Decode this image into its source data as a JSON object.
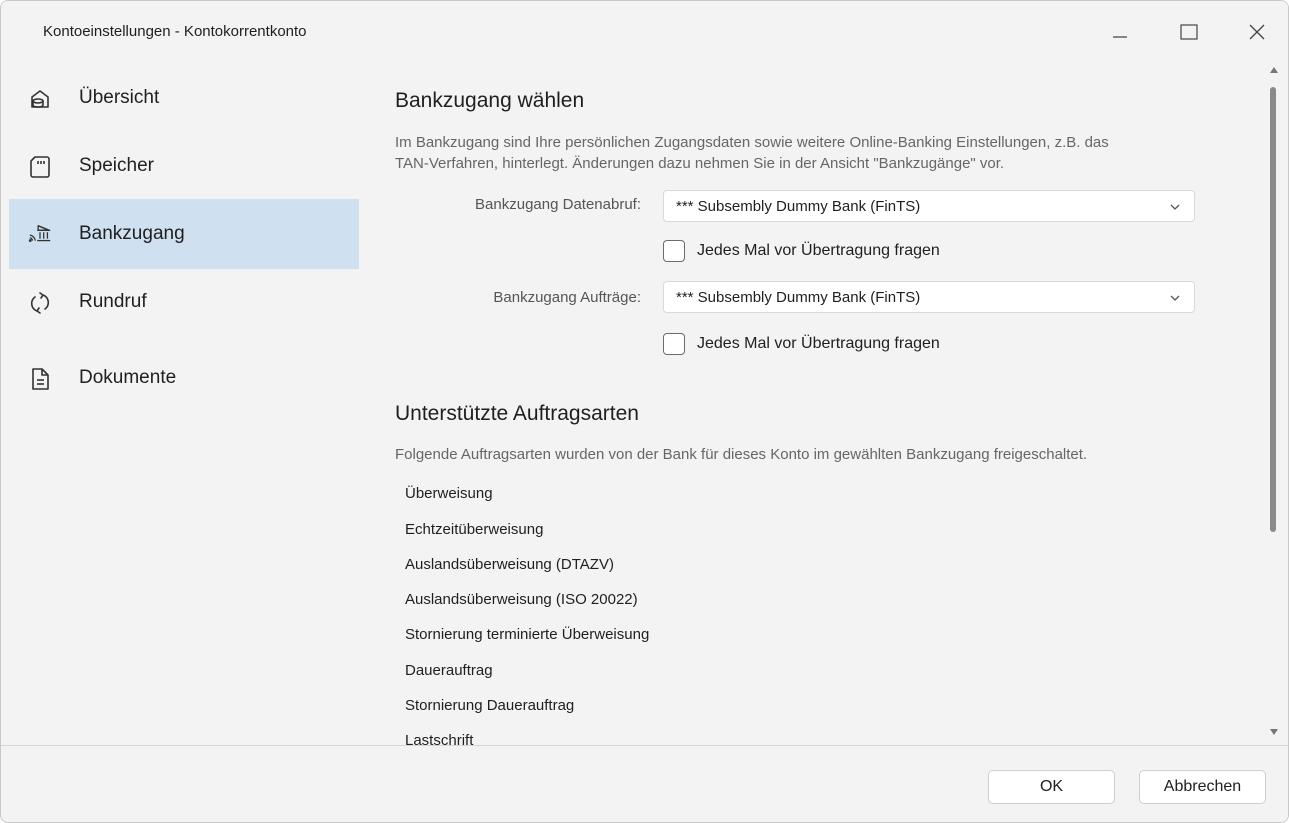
{
  "window": {
    "title": "Kontoeinstellungen - Kontokorrentkonto"
  },
  "sidebar": {
    "items": [
      {
        "label": "Übersicht",
        "icon": "overview-icon",
        "active": false
      },
      {
        "label": "Speicher",
        "icon": "storage-card-icon",
        "active": false
      },
      {
        "label": "Bankzugang",
        "icon": "bank-access-icon",
        "active": true
      },
      {
        "label": "Rundruf",
        "icon": "sync-icon",
        "active": false
      },
      {
        "label": "Dokumente",
        "icon": "document-icon",
        "active": false
      }
    ]
  },
  "bank_access": {
    "heading": "Bankzugang wählen",
    "description_line1": "Im Bankzugang sind Ihre persönlichen Zugangsdaten sowie weitere Online-Banking Einstellungen, z.B. das",
    "description_line2": "TAN-Verfahren, hinterlegt. Änderungen dazu nehmen Sie in der Ansicht \"Bankzugänge\" vor.",
    "data_retrieval_label": "Bankzugang Datenabruf:",
    "data_retrieval_value": "*** Subsembly Dummy Bank (FinTS)",
    "data_retrieval_ask_label": "Jedes Mal vor Übertragung fragen",
    "orders_label": "Bankzugang Aufträge:",
    "orders_value": "*** Subsembly Dummy Bank (FinTS)",
    "orders_ask_label": "Jedes Mal vor Übertragung fragen"
  },
  "supported_orders": {
    "heading": "Unterstützte Auftragsarten",
    "description": "Folgende Auftragsarten wurden von der Bank für dieses Konto im gewählten Bankzugang freigeschaltet.",
    "items": [
      "Überweisung",
      "Echtzeitüberweisung",
      "Auslandsüberweisung (DTAZV)",
      "Auslandsüberweisung (ISO 20022)",
      "Stornierung terminierte Überweisung",
      "Dauerauftrag",
      "Stornierung Dauerauftrag",
      "Lastschrift"
    ]
  },
  "footer": {
    "ok_label": "OK",
    "cancel_label": "Abbrechen"
  },
  "colors": {
    "active_item_bg": "#cfe0f1",
    "window_bg": "#f3f3f3",
    "secondary_text": "#666666"
  }
}
